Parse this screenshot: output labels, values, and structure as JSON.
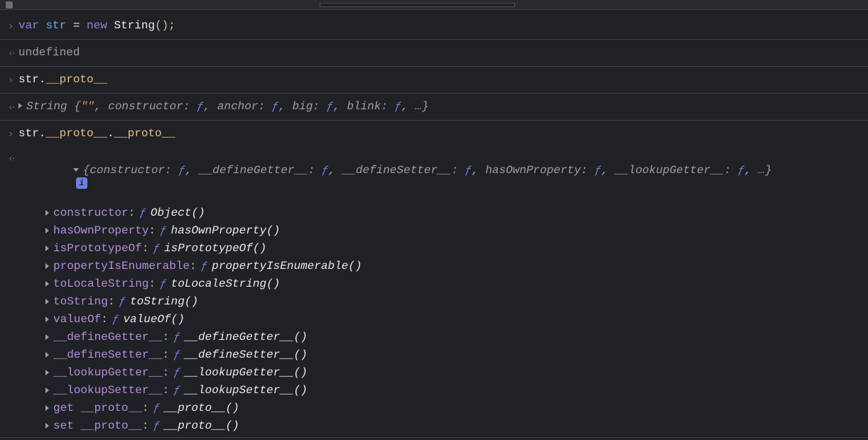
{
  "inputs": {
    "line1": {
      "var": "var",
      "name": "str",
      "eq": " = ",
      "new": "new",
      "ctor": " String",
      "call": "();"
    },
    "line3": {
      "obj": "str.",
      "proto": "__proto__"
    },
    "line5": {
      "obj": "str.",
      "proto1": "__proto__",
      "dot": ".",
      "proto2": "__proto__"
    }
  },
  "output_undefined": "undefined",
  "string_summary": {
    "lead": "String {",
    "empty": "\"\"",
    "rest": ", constructor: ",
    "f": "ƒ",
    "seg1": ", anchor: ",
    "seg2": ", big: ",
    "seg3": ", blink: ",
    "tail": ", …}"
  },
  "object_summary": {
    "lead": "{constructor: ",
    "f": "ƒ",
    "seg1": ", __defineGetter__: ",
    "seg2": ", __defineSetter__: ",
    "seg3": ", hasOwnProperty: ",
    "seg4": ", __lookupGetter__: ",
    "tail": ", …}"
  },
  "props": [
    {
      "key": "constructor",
      "fn": "Object()"
    },
    {
      "key": "hasOwnProperty",
      "fn": "hasOwnProperty()"
    },
    {
      "key": "isPrototypeOf",
      "fn": "isPrototypeOf()"
    },
    {
      "key": "propertyIsEnumerable",
      "fn": "propertyIsEnumerable()"
    },
    {
      "key": "toLocaleString",
      "fn": "toLocaleString()"
    },
    {
      "key": "toString",
      "fn": "toString()"
    },
    {
      "key": "valueOf",
      "fn": "valueOf()"
    },
    {
      "key": "__defineGetter__",
      "fn": "__defineGetter__()"
    },
    {
      "key": "__defineSetter__",
      "fn": "__defineSetter__()"
    },
    {
      "key": "__lookupGetter__",
      "fn": "__lookupGetter__()"
    },
    {
      "key": "__lookupSetter__",
      "fn": "__lookupSetter__()"
    },
    {
      "key": "get __proto__",
      "fn": "__proto__()"
    },
    {
      "key": "set __proto__",
      "fn": "__proto__()"
    }
  ],
  "f_symbol": "ƒ",
  "info_badge": "i"
}
